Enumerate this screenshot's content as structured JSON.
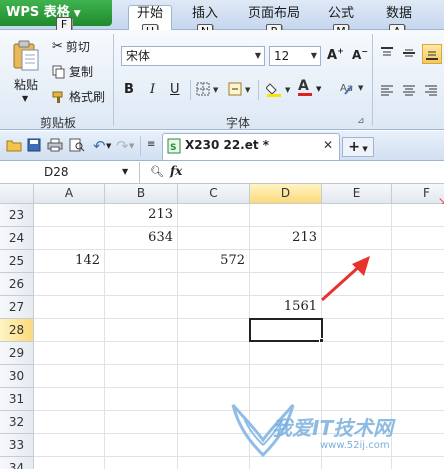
{
  "app": {
    "button_label": "WPS 表格",
    "button_keytip": "F"
  },
  "tabs": [
    {
      "label": "开始",
      "keytip": "H"
    },
    {
      "label": "插入",
      "keytip": "N"
    },
    {
      "label": "页面布局",
      "keytip": "P"
    },
    {
      "label": "公式",
      "keytip": "M"
    },
    {
      "label": "数据",
      "keytip": "A"
    }
  ],
  "ribbon": {
    "paste_label": "粘贴",
    "cut_label": "剪切",
    "copy_label": "复制",
    "format_painter_label": "格式刷",
    "clipboard_group": "剪贴板",
    "font_name": "宋体",
    "font_size": "12",
    "bold": "B",
    "italic": "I",
    "underline": "U",
    "font_group": "字体",
    "font_color_letter": "A",
    "font_color": "#e02020",
    "fill_color": "#f7e600"
  },
  "document_tab": {
    "filename": "X230 22.et *"
  },
  "formula_bar": {
    "name_box": "D28",
    "fx_label": "fx",
    "formula": ""
  },
  "grid": {
    "columns": [
      "A",
      "B",
      "C",
      "D",
      "E",
      "F"
    ],
    "active_column": "D",
    "rows": [
      "23",
      "24",
      "25",
      "26",
      "27",
      "28",
      "29",
      "30",
      "31",
      "32",
      "33",
      "34"
    ],
    "active_row": "28",
    "cells": {
      "B23": "213",
      "B24": "634",
      "D24": "213",
      "A25": "142",
      "C25": "572",
      "D27": "1561"
    },
    "selected_cell": "D28"
  },
  "annotation": {
    "arrow_color": "#e8322d"
  },
  "watermark": {
    "text": "我爱IT技术网",
    "url": "www.52ij.com"
  }
}
